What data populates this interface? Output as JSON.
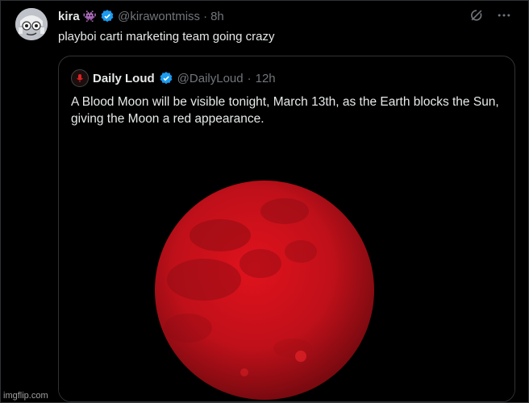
{
  "tweet": {
    "author_name": "kira",
    "author_handle": "@kirawontmiss",
    "time": "8h",
    "text": "playboi carti marketing team going crazy",
    "badge_emoji": "👾",
    "verified_color": "#1d9bf0"
  },
  "quoted": {
    "author_name": "Daily Loud",
    "author_handle": "@DailyLoud",
    "time": "12h",
    "text": "A Blood Moon will be visible tonight, March 13th, as the Earth blocks the Sun, giving the Moon a red appearance.",
    "media": {
      "icon": "blood-moon-image",
      "color": "#c4111a"
    }
  },
  "separator": "·",
  "icons": {
    "grok": "grok-icon",
    "more": "more-icon"
  },
  "watermark": "imgflip.com"
}
